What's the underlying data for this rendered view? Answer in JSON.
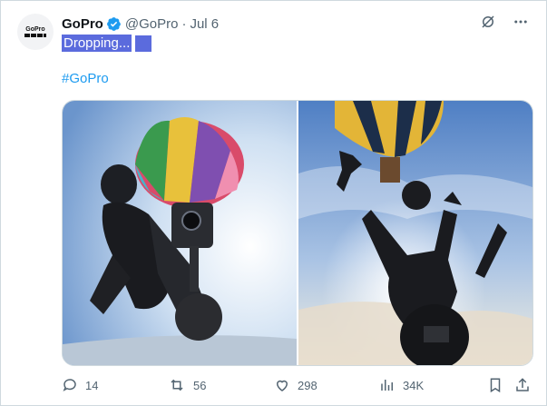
{
  "tweet": {
    "author_name": "GoPro",
    "handle": "@GoPro",
    "separator": "·",
    "date": "Jul 6",
    "text": "Dropping...",
    "hashtag": "#GoPro",
    "avatar_logo_text": "GoPro"
  },
  "actions": {
    "replies": "14",
    "reposts": "56",
    "likes": "298",
    "views": "34K"
  },
  "icons": {
    "verified": "verified-badge-icon",
    "grok": "grok-icon",
    "more": "more-icon",
    "reply": "reply-icon",
    "repost": "repost-icon",
    "like": "heart-icon",
    "views": "views-icon",
    "bookmark": "bookmark-icon",
    "share": "share-icon"
  },
  "colors": {
    "link": "#1d9bf0",
    "secondary_text": "#536471",
    "selection": "#5b6bdd",
    "verified": "#1d9bf0"
  }
}
